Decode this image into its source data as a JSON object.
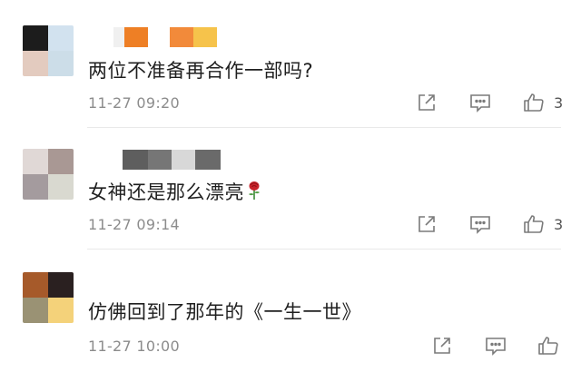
{
  "comments": [
    {
      "text": "两位不准备再合作一部吗?",
      "time": "11-27 09:20",
      "like_count": "3",
      "avatar_colors": [
        "#1c1c1c",
        "#d2e2ef",
        "#e3cbbf",
        "#ccdde8"
      ],
      "username_colors": [
        "#ffffff",
        "#f0f0f0",
        "#ee7f25",
        "#ffffff",
        "#f28a3a",
        "#f6c34b"
      ]
    },
    {
      "text": "女神还是那么漂亮",
      "time": "11-27 09:14",
      "like_count": "3",
      "avatar_colors": [
        "#e0d8d6",
        "#a99894",
        "#a49b9e",
        "#d9d9d0"
      ],
      "username_colors": [
        "#5e5e5e",
        "#767676",
        "#d8d8d8",
        "#6a6a6a"
      ],
      "emoji": "rose-emoji"
    },
    {
      "text": "仿佛回到了那年的《一生一世》",
      "time": "11-27 10:00",
      "like_count": "",
      "avatar_colors": [
        "#a65a2a",
        "#2a2020",
        "#9a9274",
        "#f4d27a"
      ],
      "username_colors": []
    }
  ],
  "icons": {
    "share": "share-icon",
    "reply": "comment-icon",
    "like": "thumbs-up-icon"
  }
}
